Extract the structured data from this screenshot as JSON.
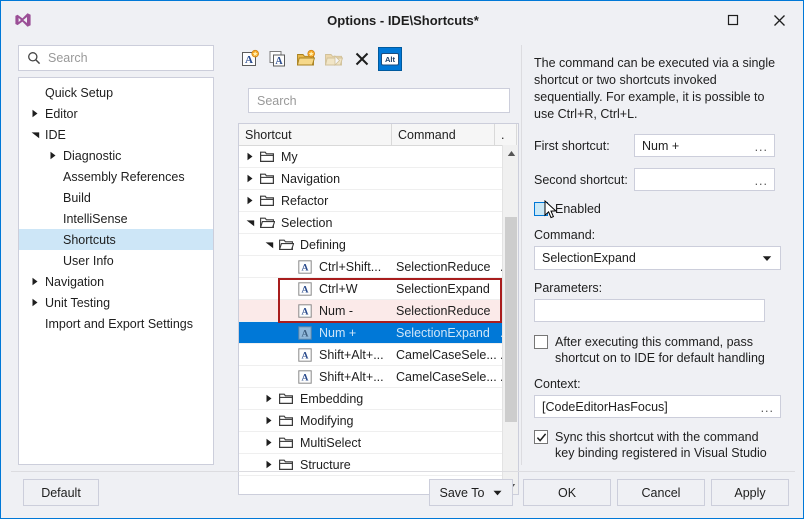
{
  "window": {
    "title": "Options - IDE\\Shortcuts*",
    "logo_icon": "visual-studio-logo-icon",
    "maximize_icon": "maximize-icon",
    "close_icon": "close-icon"
  },
  "sidebar": {
    "search": {
      "placeholder": "Search",
      "value": "",
      "icon": "search-icon"
    },
    "items": [
      {
        "label": "Quick Setup",
        "indent": 0,
        "arrow": "none",
        "selected": false
      },
      {
        "label": "Editor",
        "indent": 0,
        "arrow": "collapsed",
        "selected": false
      },
      {
        "label": "IDE",
        "indent": 0,
        "arrow": "expanded",
        "selected": false
      },
      {
        "label": "Diagnostic",
        "indent": 1,
        "arrow": "collapsed",
        "selected": false
      },
      {
        "label": "Assembly References",
        "indent": 1,
        "arrow": "none",
        "selected": false
      },
      {
        "label": "Build",
        "indent": 1,
        "arrow": "none",
        "selected": false
      },
      {
        "label": "IntelliSense",
        "indent": 1,
        "arrow": "none",
        "selected": false
      },
      {
        "label": "Shortcuts",
        "indent": 1,
        "arrow": "none",
        "selected": true
      },
      {
        "label": "User Info",
        "indent": 1,
        "arrow": "none",
        "selected": false
      },
      {
        "label": "Navigation",
        "indent": 0,
        "arrow": "collapsed",
        "selected": false
      },
      {
        "label": "Unit Testing",
        "indent": 0,
        "arrow": "collapsed",
        "selected": false
      },
      {
        "label": "Import and Export Settings",
        "indent": 0,
        "arrow": "none",
        "selected": false
      }
    ]
  },
  "middle": {
    "toolbar": [
      {
        "name": "new-shortcut-icon",
        "label": "New Shortcut",
        "state": "enabled"
      },
      {
        "name": "duplicate-shortcut-icon",
        "label": "Duplicate Shortcut",
        "state": "enabled"
      },
      {
        "name": "new-folder-icon",
        "label": "New Folder",
        "state": "enabled"
      },
      {
        "name": "duplicate-folder-icon",
        "label": "Duplicate Folder",
        "state": "disabled"
      },
      {
        "name": "delete-icon",
        "label": "Delete",
        "state": "enabled"
      },
      {
        "name": "alt-toggle-icon",
        "label": "Alt",
        "state": "active"
      }
    ],
    "search": {
      "placeholder": "Search",
      "value": ""
    },
    "columns": [
      {
        "label": "Shortcut"
      },
      {
        "label": "Command"
      },
      {
        "label": "."
      }
    ],
    "rows": [
      {
        "indent": 0,
        "arrow": "collapsed",
        "icon": "folder-closed-icon",
        "shortcut": "My",
        "command": "",
        "extra": "",
        "state": "normal"
      },
      {
        "indent": 0,
        "arrow": "collapsed",
        "icon": "folder-closed-icon",
        "shortcut": "Navigation",
        "command": "",
        "extra": "",
        "state": "normal"
      },
      {
        "indent": 0,
        "arrow": "collapsed",
        "icon": "folder-closed-icon",
        "shortcut": "Refactor",
        "command": "",
        "extra": "",
        "state": "normal"
      },
      {
        "indent": 0,
        "arrow": "expanded",
        "icon": "folder-open-icon",
        "shortcut": "Selection",
        "command": "",
        "extra": "",
        "state": "normal"
      },
      {
        "indent": 1,
        "arrow": "expanded",
        "icon": "folder-open-icon",
        "shortcut": "Defining",
        "command": "",
        "extra": "",
        "state": "normal"
      },
      {
        "indent": 2,
        "arrow": "none",
        "icon": "shortcut-a-icon",
        "shortcut": "Ctrl+Shift...",
        "command": "SelectionReduce",
        "extra": ".",
        "state": "normal"
      },
      {
        "indent": 2,
        "arrow": "none",
        "icon": "shortcut-a-icon",
        "shortcut": "Ctrl+W",
        "command": "SelectionExpand",
        "extra": ".",
        "state": "normal"
      },
      {
        "indent": 2,
        "arrow": "none",
        "icon": "shortcut-a-icon",
        "shortcut": "Num -",
        "command": "SelectionReduce",
        "extra": ".",
        "state": "marked"
      },
      {
        "indent": 2,
        "arrow": "none",
        "icon": "shortcut-a-icon",
        "shortcut": "Num +",
        "command": "SelectionExpand",
        "extra": ".",
        "state": "selected"
      },
      {
        "indent": 2,
        "arrow": "none",
        "icon": "shortcut-a-icon",
        "shortcut": "Shift+Alt+...",
        "command": "CamelCaseSele...",
        "extra": ".",
        "state": "normal"
      },
      {
        "indent": 2,
        "arrow": "none",
        "icon": "shortcut-a-icon",
        "shortcut": "Shift+Alt+...",
        "command": "CamelCaseSele...",
        "extra": ".",
        "state": "normal"
      },
      {
        "indent": 1,
        "arrow": "collapsed",
        "icon": "folder-closed-icon",
        "shortcut": "Embedding",
        "command": "",
        "extra": "",
        "state": "normal"
      },
      {
        "indent": 1,
        "arrow": "collapsed",
        "icon": "folder-closed-icon",
        "shortcut": "Modifying",
        "command": "",
        "extra": "",
        "state": "normal"
      },
      {
        "indent": 1,
        "arrow": "collapsed",
        "icon": "folder-closed-icon",
        "shortcut": "MultiSelect",
        "command": "",
        "extra": "",
        "state": "normal"
      },
      {
        "indent": 1,
        "arrow": "collapsed",
        "icon": "folder-closed-icon",
        "shortcut": "Structure",
        "command": "",
        "extra": "",
        "state": "normal"
      }
    ],
    "scrollbar": {
      "up_icon": "scroll-up-icon",
      "down_icon": "scroll-down-icon"
    }
  },
  "details": {
    "description": "The command can be executed via a single shortcut or two shortcuts invoked sequentially. For example, it is possible to use Ctrl+R, Ctrl+L.",
    "first_shortcut": {
      "label": "First shortcut:",
      "value": "Num +",
      "ellipsis": "..."
    },
    "second_shortcut": {
      "label": "Second shortcut:",
      "value": "",
      "ellipsis": "..."
    },
    "enabled": {
      "label": "Enabled",
      "checked": false,
      "hover": true
    },
    "command": {
      "label": "Command:",
      "value": "SelectionExpand",
      "arrow_icon": "chevron-down-icon"
    },
    "parameters": {
      "label": "Parameters:",
      "value": "",
      "placeholder": ""
    },
    "pass_shortcut": {
      "label": "After executing this command, pass shortcut on to IDE for default handling",
      "checked": false
    },
    "context": {
      "label": "Context:",
      "value": "[CodeEditorHasFocus]",
      "ellipsis": "..."
    },
    "sync": {
      "label": "Sync this shortcut with the command key binding registered in Visual Studio",
      "checked": true
    }
  },
  "footer": {
    "default": "Default",
    "save_to": "Save To",
    "save_to_arrow_icon": "dropdown-arrow-icon",
    "ok": "OK",
    "cancel": "Cancel",
    "apply": "Apply"
  },
  "colors": {
    "accent": "#0078d7",
    "selection_highlight": "#cde6f7",
    "marked_row": "#fbeae9",
    "marked_border": "#a81d1d",
    "window_bg": "#eff0f4"
  }
}
